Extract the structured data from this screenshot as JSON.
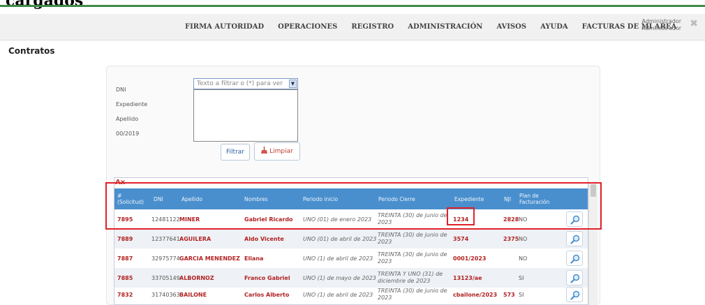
{
  "page": {
    "cut_title": "cargados"
  },
  "nav": {
    "items": [
      "FIRMA AUTORIDAD",
      "OPERACIONES",
      "REGISTRO",
      "ADMINISTRACIÓN",
      "AVISOS",
      "AYUDA",
      "FACTURAS DE MI AREA"
    ]
  },
  "user": {
    "line1": "Administrador",
    "line2": "Administrador",
    "logout_icon": "close-x-icon"
  },
  "section_title": "Contratos",
  "filters": {
    "labels": [
      "DNI",
      "Expediente",
      "Apellido",
      "00/2019"
    ],
    "select_placeholder": "Texto a filtrar o (*) para ver todo",
    "filter_button": "Filtrar",
    "clear_button": "Limpiar"
  },
  "grid": {
    "tool_label": "Ax",
    "headers": {
      "solicitud": "# (Solicitud)",
      "dni": "DNI",
      "apellido": "Apellido",
      "nombres": "Nombres",
      "inicio": "Periodo inicio",
      "cierre": "Periodo Cierre",
      "expediente": "Expediente",
      "nji": "NJI",
      "plan": "Plan de Facturación"
    },
    "rows": [
      {
        "solicitud": "7895",
        "dni": "12481122",
        "apellido": "MINER",
        "nombres": "Gabriel Ricardo",
        "inicio": "UNO (01) de enero 2023",
        "cierre": "TREINTA (30) de junio de 2023",
        "expediente": "1234",
        "nji": "2828",
        "plan": "NO"
      },
      {
        "solicitud": "7889",
        "dni": "12377641",
        "apellido": "AGUILERA",
        "nombres": "Aldo Vicente",
        "inicio": "UNO (01) de abril de 2023",
        "cierre": "TREINTA (30) de junio de 2023",
        "expediente": "3574",
        "nji": "2375",
        "plan": "NO"
      },
      {
        "solicitud": "7887",
        "dni": "32975774",
        "apellido": "GARCIA MENENDEZ",
        "nombres": "Eliana",
        "inicio": "UNO (1) de abril de 2023",
        "cierre": "TREINTA (30) de junio de 2023",
        "expediente": "0001/2023",
        "nji": "",
        "plan": "NO"
      },
      {
        "solicitud": "7885",
        "dni": "33705149",
        "apellido": "ALBORNOZ",
        "nombres": "Franco Gabriel",
        "inicio": "UNO (1) de mayo de 2023",
        "cierre": "TREINTA Y UNO (31) de diciembre de 2023",
        "expediente": "13123/ae",
        "nji": "",
        "plan": "SI"
      },
      {
        "solicitud": "7832",
        "dni": "31740363",
        "apellido": "BAILONE",
        "nombres": "Carlos Alberto",
        "inicio": "UNO (1) de abril de 2023",
        "cierre": "TREINTA (30) de junio de 2023",
        "expediente": "cbailone/2023",
        "nji": "573",
        "plan": "SI"
      }
    ],
    "view_icon": "magnifier-icon",
    "colors": {
      "header": "#4a8fcd",
      "link": "#b22222",
      "highlight": "#e0222a"
    }
  }
}
